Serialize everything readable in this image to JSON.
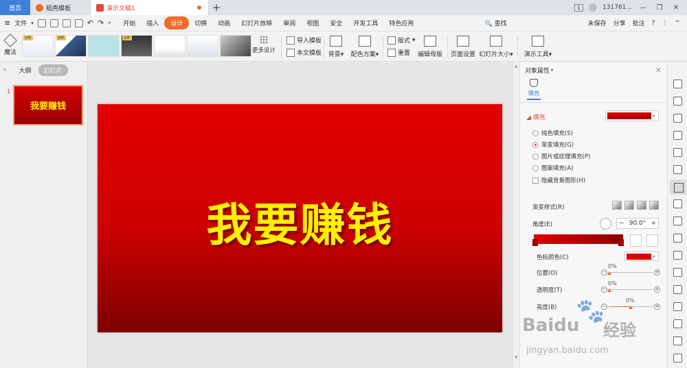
{
  "titlebar": {
    "home_tab": "首页",
    "docer_tab": "稻壳模板",
    "doc_tab": "演示文稿1",
    "new_tab": "+",
    "page_badge": "1",
    "user": "131761...",
    "min": "—",
    "restore": "❐",
    "close": "✕"
  },
  "menubar": {
    "file": "文件",
    "items": [
      "开始",
      "插入",
      "设计",
      "切换",
      "动画",
      "幻灯片放映",
      "审阅",
      "视图",
      "安全",
      "开发工具",
      "特色应用"
    ],
    "active_index": 2,
    "search": "查找",
    "unsaved": "未保存",
    "share": "分享",
    "comment": "批注",
    "help": "?",
    "more": "⋮",
    "collapse": "^"
  },
  "ribbon": {
    "magic": "魔法",
    "vip": "VIP",
    "more_design": "更多设计",
    "import_template": "导入模板",
    "body_template": "本文模板",
    "background": "背景",
    "color_scheme": "配色方案",
    "layout": "版式",
    "reset": "重置",
    "edit_master": "编辑母版",
    "page_setup": "页面设置",
    "slide_size": "幻灯片大小",
    "presentation_tools": "演示工具"
  },
  "leftpanel": {
    "outline_tab": "大纲",
    "slides_tab": "幻灯片",
    "collapse": "«",
    "slides": [
      {
        "number": "1",
        "title": "我要赚钱"
      }
    ]
  },
  "slide": {
    "text": "我要赚钱"
  },
  "rpanel": {
    "title": "对象属性",
    "fill_tab": "填充",
    "fill_section": "填充",
    "options": [
      {
        "label": "纯色填充(S)",
        "checked": false
      },
      {
        "label": "渐变填充(G)",
        "checked": true
      },
      {
        "label": "图片或纹理填充(P)",
        "checked": false
      },
      {
        "label": "图案填充(A)",
        "checked": false
      }
    ],
    "hide_bg": "隐藏背景图形(H)",
    "gradient_style": "渐变样式(R)",
    "angle_label": "角度(E)",
    "angle_value": "90.0°",
    "stop_color": "色标颜色(C)",
    "position_label": "位置(O)",
    "position_value": "0%",
    "transparency_label": "透明度(T)",
    "transparency_value": "0%",
    "brightness_label": "亮度(B)",
    "brightness_value": "0%"
  },
  "watermark": {
    "brand": "Baidu",
    "jingyan": "经验",
    "url": "jingyan.baidu.com"
  },
  "colors": {
    "accent": "#ef6c2d",
    "home_tab": "#3d7fd9",
    "slide_red": "#d40000",
    "slide_text": "#ffef00"
  }
}
